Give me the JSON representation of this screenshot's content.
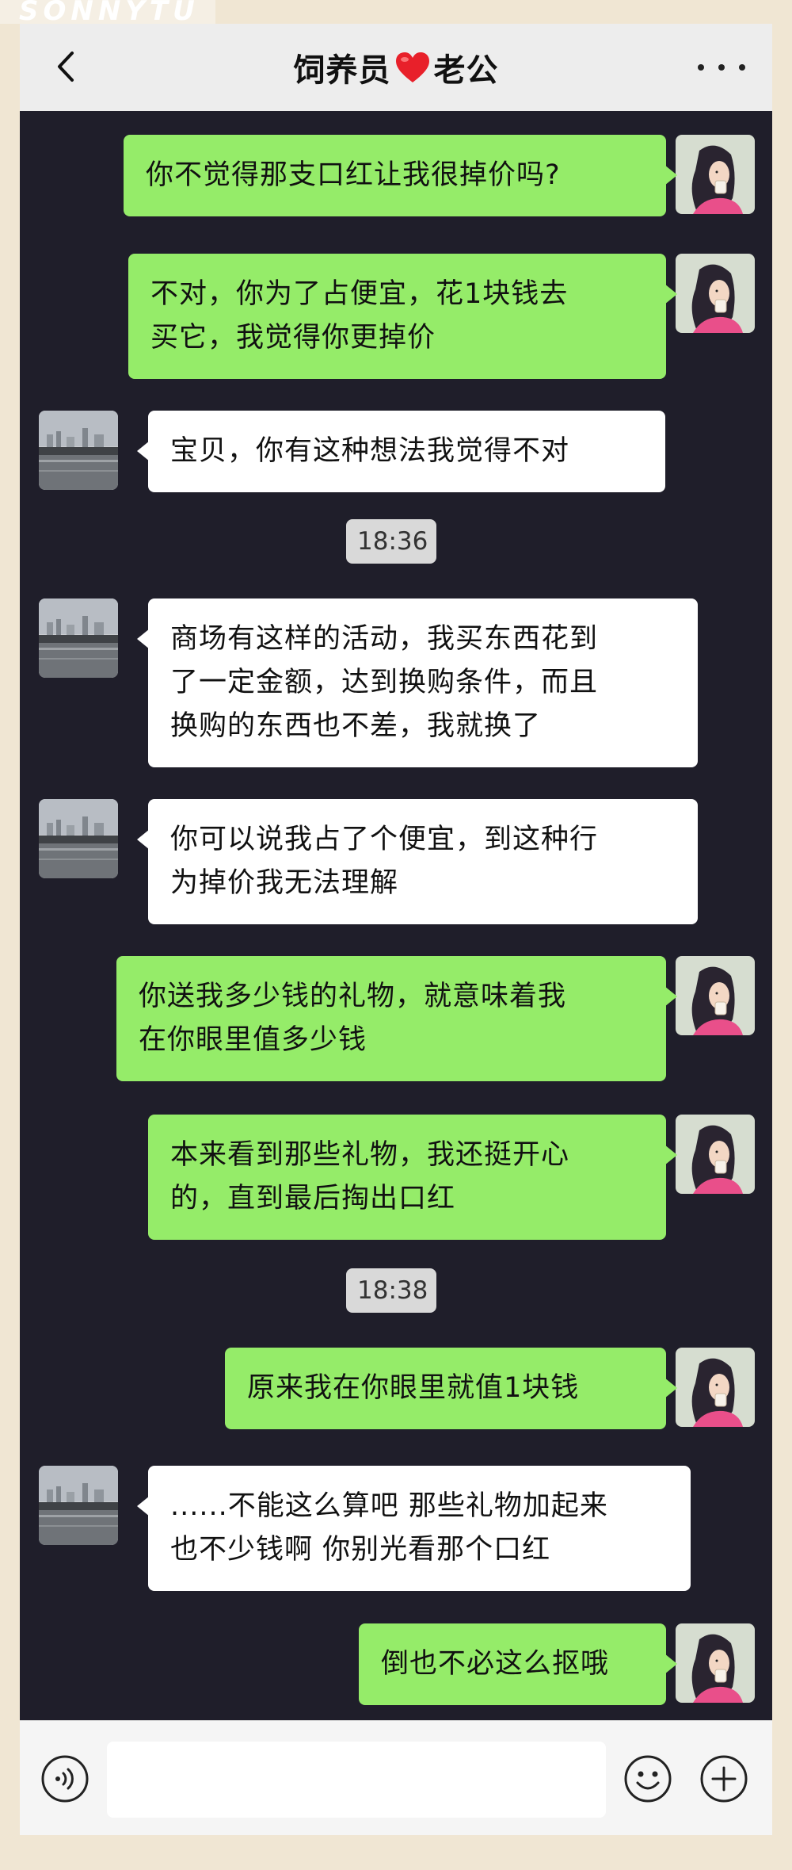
{
  "watermark": "SONNYTU",
  "chat": {
    "title_left": "饲养员",
    "title_right": "老公"
  },
  "messages": [
    {
      "from": "me",
      "lines": [
        "你不觉得那支口红让我很掉价吗?"
      ]
    },
    {
      "from": "me",
      "lines": [
        "不对，你为了占便宜，花1块钱去",
        "买它，我觉得你更掉价"
      ]
    },
    {
      "from": "him",
      "lines": [
        "宝贝，你有这种想法我觉得不对"
      ]
    },
    {
      "time": "18:36"
    },
    {
      "from": "him",
      "lines": [
        "商场有这样的活动，我买东西花到",
        "了一定金额，达到换购条件，而且",
        "换购的东西也不差，我就换了"
      ]
    },
    {
      "from": "him",
      "lines": [
        "你可以说我占了个便宜，到这种行",
        "为掉价我无法理解"
      ]
    },
    {
      "from": "me",
      "lines": [
        "你送我多少钱的礼物，就意味着我",
        "在你眼里值多少钱"
      ]
    },
    {
      "from": "me",
      "lines": [
        "本来看到那些礼物，我还挺开心",
        "的，直到最后掏出口红"
      ]
    },
    {
      "time": "18:38"
    },
    {
      "from": "me",
      "lines": [
        "原来我在你眼里就值1块钱"
      ]
    },
    {
      "from": "him",
      "lines": [
        "......不能这么算吧 那些礼物加起来",
        "也不少钱啊 你别光看那个口红"
      ]
    },
    {
      "from": "me",
      "lines": [
        "倒也不必这么抠哦"
      ]
    }
  ],
  "icons": {
    "back": "chevron-left-icon",
    "heart": "red-heart-icon",
    "more": "more-dots-icon",
    "voice": "voice-icon",
    "emoji": "emoji-icon",
    "plus": "plus-icon"
  },
  "colors": {
    "my_bubble": "#95ec69",
    "his_bubble": "#ffffff",
    "chat_background": "#1f1e2a",
    "heart": "#e8202a"
  },
  "composer": {
    "value": ""
  }
}
